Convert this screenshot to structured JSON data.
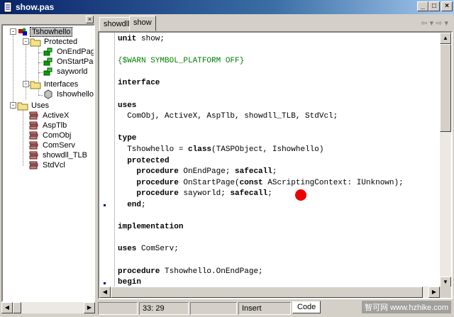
{
  "window": {
    "title": "show.pas"
  },
  "explorer": {
    "nodes": [
      {
        "label": "Tshowhello",
        "icon": "class-icon",
        "selected": true
      },
      {
        "label": "Protected",
        "icon": "folder-icon"
      },
      {
        "label": "OnEndPage",
        "icon": "method-icon"
      },
      {
        "label": "OnStartPage",
        "icon": "method-icon"
      },
      {
        "label": "sayworld",
        "icon": "method-icon"
      },
      {
        "label": "Interfaces",
        "icon": "folder-icon"
      },
      {
        "label": "Ishowhello",
        "icon": "interface-icon"
      },
      {
        "label": "Uses",
        "icon": "folder-icon"
      },
      {
        "label": "ActiveX",
        "icon": "unit-icon"
      },
      {
        "label": "AspTlb",
        "icon": "unit-icon"
      },
      {
        "label": "ComObj",
        "icon": "unit-icon"
      },
      {
        "label": "ComServ",
        "icon": "unit-icon"
      },
      {
        "label": "showdll_TLB",
        "icon": "unit-icon"
      },
      {
        "label": "StdVcl",
        "icon": "unit-icon"
      }
    ]
  },
  "tabs": [
    {
      "label": "showdll",
      "active": false
    },
    {
      "label": "show",
      "active": true
    }
  ],
  "editor": {
    "lines": [
      [
        {
          "t": "unit",
          "k": "kw"
        },
        {
          "t": " show;",
          "k": ""
        }
      ],
      [],
      [
        {
          "t": "{$WARN SYMBOL_PLATFORM OFF}",
          "k": "dir"
        }
      ],
      [],
      [
        {
          "t": "interface",
          "k": "kw"
        }
      ],
      [],
      [
        {
          "t": "uses",
          "k": "kw"
        }
      ],
      [
        {
          "t": "  ComObj, ActiveX, AspTlb, showdll_TLB, StdVcl;",
          "k": ""
        }
      ],
      [],
      [
        {
          "t": "type",
          "k": "kw"
        }
      ],
      [
        {
          "t": "  Tshowhello = ",
          "k": ""
        },
        {
          "t": "class",
          "k": "kw"
        },
        {
          "t": "(TASPObject, Ishowhello)",
          "k": ""
        }
      ],
      [
        {
          "t": "  protected",
          "k": "kw"
        }
      ],
      [
        {
          "t": "    procedure",
          "k": "kw"
        },
        {
          "t": " OnEndPage; ",
          "k": ""
        },
        {
          "t": "safecall",
          "k": "kw"
        },
        {
          "t": ";",
          "k": ""
        }
      ],
      [
        {
          "t": "    procedure",
          "k": "kw"
        },
        {
          "t": " OnStartPage(",
          "k": ""
        },
        {
          "t": "const",
          "k": "kw"
        },
        {
          "t": " AScriptingContext: IUnknown);",
          "k": ""
        }
      ],
      [
        {
          "t": "    procedure",
          "k": "kw"
        },
        {
          "t": " sayworld; ",
          "k": ""
        },
        {
          "t": "safecall",
          "k": "kw"
        },
        {
          "t": ";",
          "k": ""
        }
      ],
      [
        {
          "t": "  end",
          "k": "kw"
        },
        {
          "t": ";",
          "k": ""
        }
      ],
      [],
      [
        {
          "t": "implementation",
          "k": "kw"
        }
      ],
      [],
      [
        {
          "t": "uses",
          "k": "kw"
        },
        {
          "t": " ComServ;",
          "k": ""
        }
      ],
      [],
      [
        {
          "t": "procedure",
          "k": "kw"
        },
        {
          "t": " Tshowhello.OnEndPage;",
          "k": ""
        }
      ],
      [
        {
          "t": "begin",
          "k": "kw"
        }
      ]
    ]
  },
  "status": {
    "position": "33: 29",
    "mode": "Insert",
    "view_tab": "Code"
  },
  "watermark": "智可网 www.hzhike.com"
}
